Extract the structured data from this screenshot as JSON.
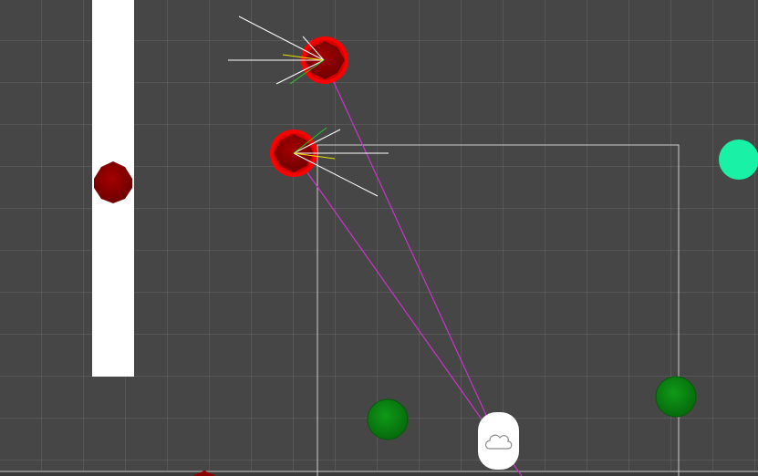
{
  "scene": {
    "background": "#464646",
    "grid_color": "#5a5a5a",
    "wall_color": "#ffffff",
    "bounds_color": "#cfcfcf",
    "enemy_color": "#8b0000",
    "enemy_alert_color": "#ff0000",
    "pickup_color": "#0a8a12",
    "goal_color": "#19f2a6",
    "sight_line_color": "#cc33cc",
    "view_ray_color": "#ffffff",
    "view_ray_mid_color": "#e6e600",
    "view_ray_near_color": "#22cc22",
    "player_icon": "cloud-icon"
  }
}
